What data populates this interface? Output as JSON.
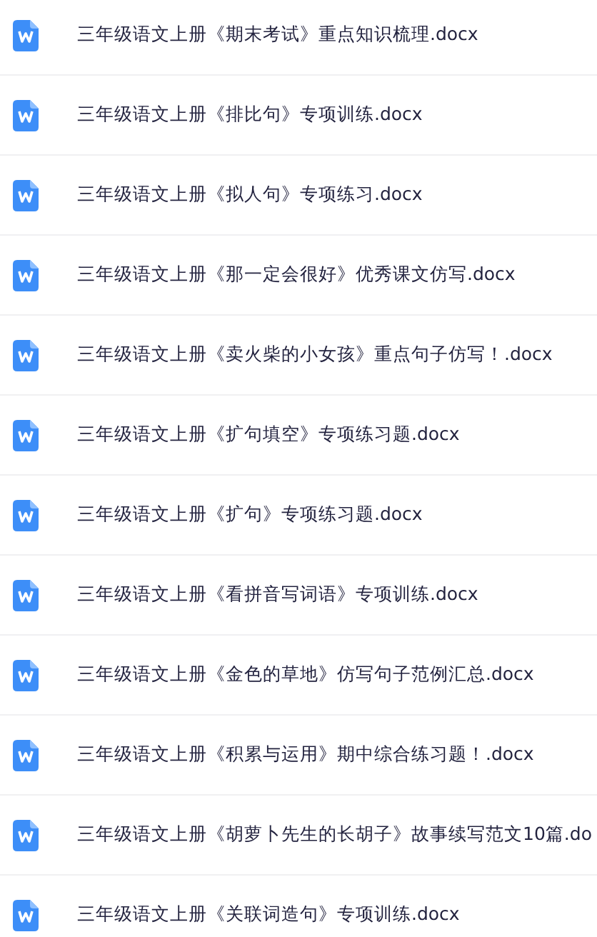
{
  "files": [
    {
      "name": "三年级语文上册《期末考试》重点知识梳理.docx"
    },
    {
      "name": "三年级语文上册《排比句》专项训练.docx"
    },
    {
      "name": "三年级语文上册《拟人句》专项练习.docx"
    },
    {
      "name": "三年级语文上册《那一定会很好》优秀课文仿写.docx"
    },
    {
      "name": "三年级语文上册《卖火柴的小女孩》重点句子仿写！.docx"
    },
    {
      "name": "三年级语文上册《扩句填空》专项练习题.docx"
    },
    {
      "name": "三年级语文上册《扩句》专项练习题.docx"
    },
    {
      "name": "三年级语文上册《看拼音写词语》专项训练.docx"
    },
    {
      "name": "三年级语文上册《金色的草地》仿写句子范例汇总.docx"
    },
    {
      "name": "三年级语文上册《积累与运用》期中综合练习题！.docx"
    },
    {
      "name": "三年级语文上册《胡萝卜先生的长胡子》故事续写范文10篇.do"
    },
    {
      "name": "三年级语文上册《关联词造句》专项训练.docx"
    }
  ]
}
